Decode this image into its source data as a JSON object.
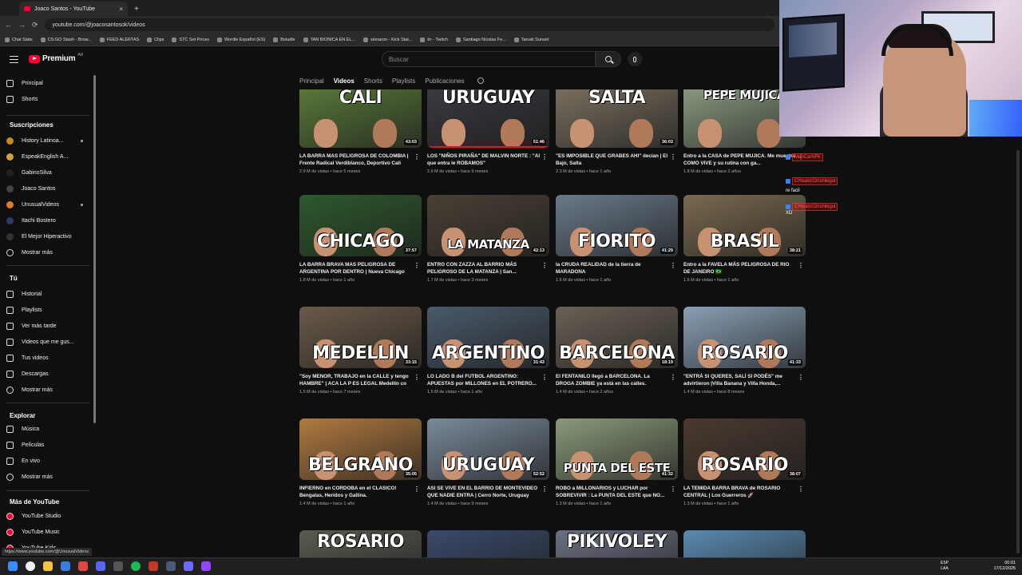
{
  "browser": {
    "tab_title": "Joaco Santos - YouTube",
    "new_tab": "+",
    "url": "youtube.com/@joacosantosok/videos",
    "bookmarks": [
      "Chat Stats",
      "CS:GO Stash - Brow...",
      "FEED ALERTAS",
      "Clips",
      "STC Set Prices",
      "Wordle Español (ES)",
      "Boludle",
      "TAN BIONICA EN EL...",
      "sionaron - Kick Stat...",
      "trr - Twitch",
      "Santiago Nicolas Fe...",
      "Tanuki Sunset"
    ]
  },
  "header": {
    "logo_text": "Premium",
    "region": "AR",
    "search_placeholder": "Buscar"
  },
  "sidebar": {
    "main": [
      {
        "label": "Principal",
        "icon": "home-icon"
      },
      {
        "label": "Shorts",
        "icon": "shorts-icon"
      }
    ],
    "subscriptions_title": "Suscripciones",
    "subscriptions": [
      {
        "label": "History Latinoa...",
        "color": "#c88a1f"
      },
      {
        "label": "EspeakEnglish A...",
        "color": "#d4a23a"
      },
      {
        "label": "GabinoSilva",
        "color": "#222222"
      },
      {
        "label": "Joaco Santos",
        "color": "#444444"
      },
      {
        "label": "UnusualVideos",
        "color": "#e27a2b"
      },
      {
        "label": "Itachi Bostero",
        "color": "#2c3b6b"
      },
      {
        "label": "El Mejor Hiperactivo",
        "color": "#333333"
      }
    ],
    "show_more": "Mostrar más",
    "you_title": "Tú",
    "you_items": [
      {
        "label": "Historial",
        "icon": "history-icon"
      },
      {
        "label": "Playlists",
        "icon": "playlists-icon"
      },
      {
        "label": "Ver más tarde",
        "icon": "watch-later-icon"
      },
      {
        "label": "Videos que me gus...",
        "icon": "like-icon"
      },
      {
        "label": "Tus videos",
        "icon": "your-videos-icon"
      },
      {
        "label": "Descargas",
        "icon": "downloads-icon"
      }
    ],
    "explore_title": "Explorar",
    "explore_items": [
      {
        "label": "Música",
        "icon": "music-icon"
      },
      {
        "label": "Películas",
        "icon": "movies-icon"
      },
      {
        "label": "En vivo",
        "icon": "live-icon"
      }
    ],
    "more_title": "Más de YouTube",
    "more_items": [
      {
        "label": "YouTube Studio"
      },
      {
        "label": "YouTube Music"
      },
      {
        "label": "YouTube Kids"
      }
    ]
  },
  "channel_tabs": {
    "items": [
      "Principal",
      "Videos",
      "Shorts",
      "Playlists",
      "Publicaciones"
    ],
    "active": "Videos"
  },
  "videos": [
    {
      "title": "LA BARRA MAS PELIGROSA DE COLOMBIA | Frente Radical Verdiblanco, Deportivo Cali",
      "meta": "2.9 M de vistas • hace 5 meses",
      "duration": "43:03",
      "overlay": "CALI",
      "bg": "#5a7a3a"
    },
    {
      "title": "LOS \"NIÑOS PIRAÑA\" DE MALVIN NORTE : \"Al que entra le ROBAMOS\"",
      "meta": "2.6 M de vistas • hace 9 meses",
      "duration": "51:46",
      "overlay": "URUGUAY",
      "bg": "#3a3a40",
      "progress": 1.0
    },
    {
      "title": "\"ES IMPOSIBLE QUE GRABES AHI\" decían | El Bajo, Salta",
      "meta": "2.3 M de vistas • hace 1 año",
      "duration": "36:03",
      "overlay": "SALTA",
      "bg": "#7a7060"
    },
    {
      "title": "Entro a la CASA de PEPE MUJICA. Me muestra COMO VIVE y su rutina con ga...",
      "meta": "1.8 M de vistas • hace 2 años",
      "duration": "",
      "overlay": "PEPE MUJICA",
      "bg": "#8a9a80"
    },
    {
      "title": "LA BARRA BRAVA MAS PELIGROSA DE ARGENTINA POR DENTRO | Nueva Chicago",
      "meta": "1.8 M de vistas • hace 1 año",
      "duration": "37:57",
      "overlay": "CHICAGO",
      "bg": "#2e5a2e"
    },
    {
      "title": "ENTRO CON ZAZZA AL BARRIO MÁS PELIGROSO DE LA MATANZA | San...",
      "meta": "1.7 M de vistas • hace 3 meses",
      "duration": "42:13",
      "overlay": "LA MATANZA",
      "bg": "#4a4035"
    },
    {
      "title": "la CRUDA REALIDAD de la tierra de MARADONA",
      "meta": "1.6 M de vistas • hace 1 año",
      "duration": "41:29",
      "overlay": "FIORITO",
      "bg": "#6a7a8a"
    },
    {
      "title": "Entro a la FAVELA MÁS PELIGROSA DE RIO DE JANEIRO 🇧🇷",
      "meta": "1.6 M de vistas • hace 1 año",
      "duration": "38:21",
      "overlay": "BRASIL",
      "bg": "#7a6a50"
    },
    {
      "title": "\"Soy MENOR, TRABAJO en la CALLE y tengo HAMBRE\" | ACA LA P ES LEGAL Medellín co",
      "meta": "1.5 M de vistas • hace 7 meses",
      "duration": "33:15",
      "overlay": "MEDELLIN",
      "bg": "#6a5a4a"
    },
    {
      "title": "LO LADO B del FUTBOL ARGENTINO: APUESTAS por MILLONES en EL POTRERO...",
      "meta": "1.5 M de vistas • hace 1 año",
      "duration": "31:43",
      "overlay": "ARGENTINO",
      "bg": "#4a5a6a"
    },
    {
      "title": "El FENTANILO llegó a BARCELONA. La DROGA ZOMBIE ya está en las calles.",
      "meta": "1.4 M de vistas • hace 2 años",
      "duration": "18:19",
      "overlay": "BARCELONA",
      "bg": "#6a6055"
    },
    {
      "title": "\"ENTRÁ SI QUERES, SALÍ SI PODÉS\" me advirtieron |Villa Banana y Villa Honda,...",
      "meta": "1.4 M de vistas • hace 8 meses",
      "duration": "41:33",
      "overlay": "ROSARIO",
      "bg": "#8aa0b5"
    },
    {
      "title": "INFIERNO en CORDOBA en el CLASICO! Bengalas, Heridos y Gallina.",
      "meta": "1.4 M de vistas • hace 1 año",
      "duration": "35:05",
      "overlay": "BELGRANO",
      "bg": "#b07a40"
    },
    {
      "title": "ASI SE VIVE EN EL BARRIO DE MONTEVIDEO QUE NADIE ENTRA | Cerro Norte, Uruguay",
      "meta": "1.4 M de vistas • hace 9 meses",
      "duration": "52:52",
      "overlay": "URUGUAY",
      "bg": "#7a8a9a"
    },
    {
      "title": "ROBO a MILLONARIOS y LUCHAR por SOBREVIVIR : La PUNTA DEL ESTE que NO...",
      "meta": "1.3 M de vistas • hace 1 año",
      "duration": "41:32",
      "overlay": "PUNTA DEL ESTE",
      "bg": "#8a9a7a"
    },
    {
      "title": "LA TEMIDA BARRA BRAVA de ROSARIO CENTRAL | Los Guerreros 🚀",
      "meta": "1.3 M de vistas • hace 1 año",
      "duration": "38:07",
      "overlay": "ROSARIO",
      "bg": "#4a3a30"
    },
    {
      "title": "",
      "meta": "",
      "duration": "",
      "overlay": "ROSARIO",
      "bg": "#5a5a50"
    },
    {
      "title": "",
      "meta": "",
      "duration": "",
      "overlay": "",
      "bg": "#3a4a6a"
    },
    {
      "title": "",
      "meta": "",
      "duration": "",
      "overlay": "PIKIVOLEY",
      "bg": "#6a7080"
    },
    {
      "title": "",
      "meta": "",
      "duration": "",
      "overlay": "",
      "bg": "#5a8ab0"
    }
  ],
  "chat": [
    {
      "name": "MenCarAFK",
      "text": ""
    },
    {
      "name": "CHisato02nshikigui",
      "text": ""
    },
    {
      "name": "",
      "text": "re facil"
    },
    {
      "name": "CHisato02nshikigui",
      "text": ""
    },
    {
      "name": "",
      "text": "XD"
    }
  ],
  "status_url": "https://www.youtube.com/@UnusualVideos",
  "taskbar": {
    "lang": "ESP",
    "lang2": "LAA",
    "time": "00:01",
    "date": "17/12/2025"
  },
  "colors": {
    "accent": "#ff0033",
    "background": "#0f0f0f"
  }
}
